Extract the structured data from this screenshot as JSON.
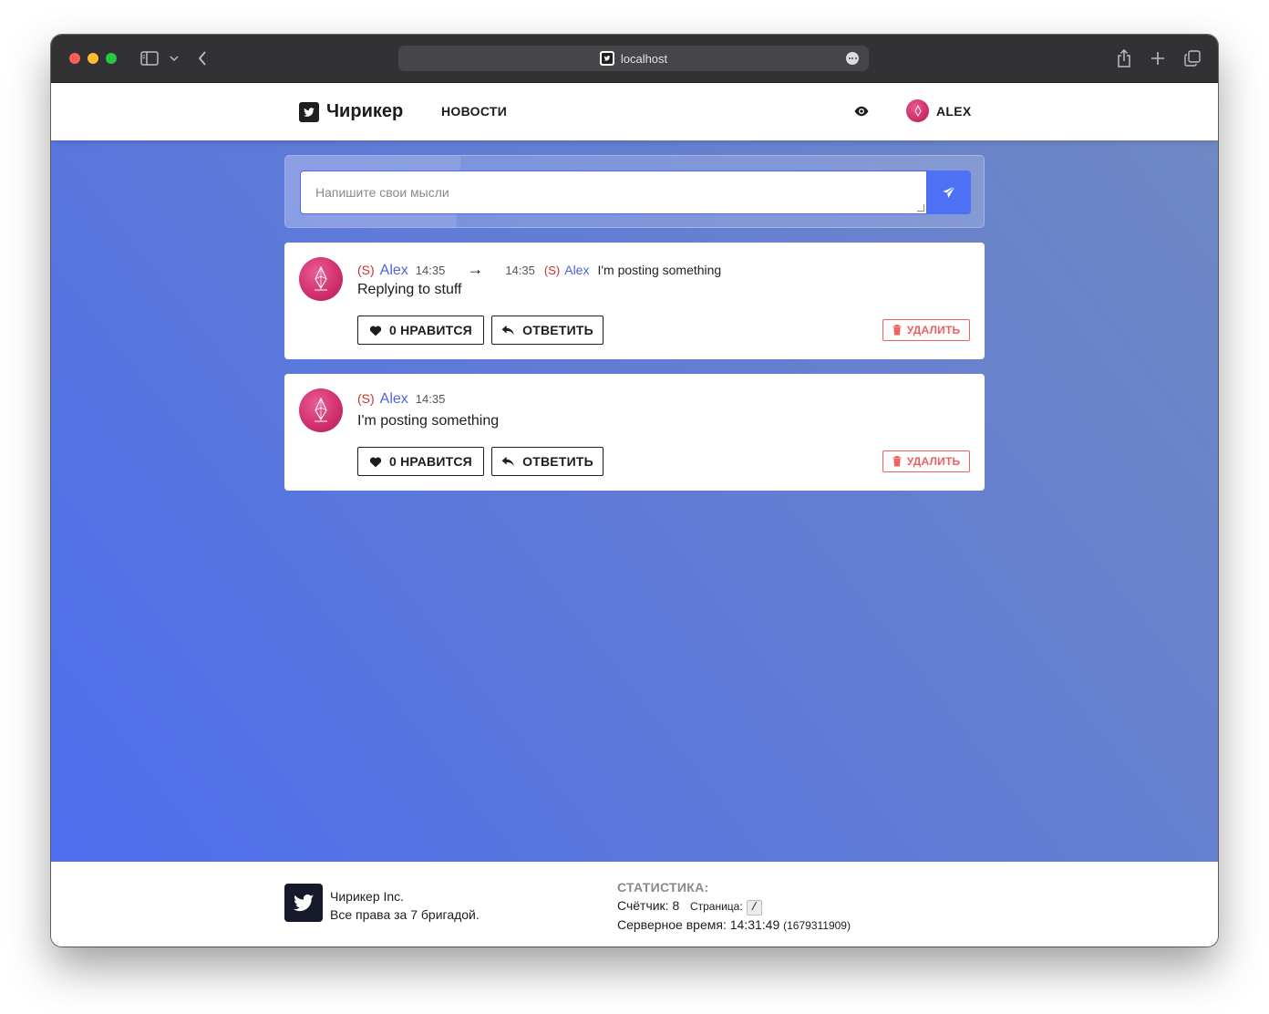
{
  "browser": {
    "url": "localhost"
  },
  "navbar": {
    "brand": "Чирикер",
    "news_link": "НОВОСТИ",
    "user_name": "ALEX"
  },
  "composer": {
    "placeholder": "Напишите свои мысли"
  },
  "posts": [
    {
      "status": "(S)",
      "author": "Alex",
      "time": "14:35",
      "reply_to": {
        "time": "14:35",
        "status": "(S)",
        "author": "Alex",
        "text": "I'm posting something"
      },
      "text": "Replying to stuff",
      "like_label": "0 НРАВИТСЯ",
      "reply_label": "ОТВЕТИТЬ",
      "delete_label": "УДАЛИТЬ"
    },
    {
      "status": "(S)",
      "author": "Alex",
      "time": "14:35",
      "text": "I'm posting something",
      "like_label": "0 НРАВИТСЯ",
      "reply_label": "ОТВЕТИТЬ",
      "delete_label": "УДАЛИТЬ"
    }
  ],
  "footer": {
    "company": "Чирикер Inc.",
    "rights": "Все права за 7 бригадой.",
    "stats_title": "СТАТИСТИКА:",
    "counter_label": "Счётчик:",
    "counter_value": "8",
    "page_label": "Страница:",
    "page_value": "/",
    "server_time_label": "Серверное время:",
    "server_time_value": "14:31:49",
    "server_timestamp": "(1679311909)"
  },
  "colors": {
    "accent": "#4e70f4",
    "author_link": "#4a63e2",
    "status_red": "#c9302c",
    "delete_red": "#f06060"
  }
}
